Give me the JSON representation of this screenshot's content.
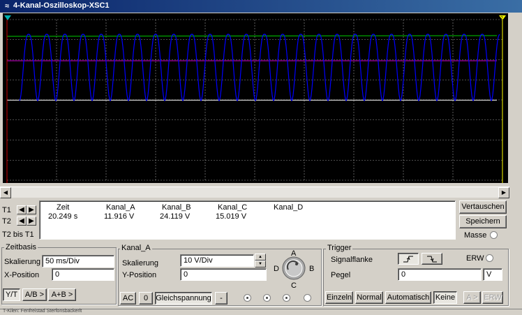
{
  "window": {
    "title": "4-Kanal-Oszilloskop-XSC1",
    "status_text": "T-Kilen: Fenfreistad Sterfonsbackerlt"
  },
  "scope_colors": {
    "background": "#000000",
    "grid": "#ffffff",
    "channel_a": "#00cc00",
    "channel_b": "#0000ff",
    "channel_c": "#cc00cc",
    "channel_d": "#ffffff",
    "cursor_t1": "#cc0000",
    "cursor_t2": "#ffff00"
  },
  "cursors": {
    "t1_label": "T1",
    "t2_label": "T2",
    "t2_bis_t1_label": "T2 bis T1",
    "t1_marker": "1",
    "t2_marker": "2"
  },
  "readout": {
    "headers": [
      "Zeit",
      "Kanal_A",
      "Kanal_B",
      "Kanal_C",
      "Kanal_D"
    ],
    "t1_values": [
      "20.249 s",
      "11.916 V",
      "24.119 V",
      "15.019 V",
      ""
    ]
  },
  "right_panel": {
    "vertauschen": "Vertauschen",
    "speichern": "Speichern",
    "masse": "Masse"
  },
  "zeitbasis": {
    "title": "Zeitbasis",
    "skalierung_label": "Skalierung",
    "skalierung_value": "50 ms/Div",
    "xposition_label": "X-Position",
    "xposition_value": "0",
    "mode_yt": "Y/T",
    "mode_ab": "A/B >",
    "mode_apb": "A+B >"
  },
  "kanal": {
    "title": "Kanal_A",
    "skalierung_label": "Skalierung",
    "skalierung_value": "10  V/Div",
    "yposition_label": "Y-Position",
    "yposition_value": "0",
    "ac": "AC",
    "zero": "0",
    "gleichspannung": "Gleichspannung",
    "minus": "-",
    "knob_labels": {
      "a": "A",
      "b": "B",
      "c": "C",
      "d": "D"
    }
  },
  "trigger": {
    "title": "Trigger",
    "signalflanke_label": "Signalflanke",
    "rising_icon": "⨏",
    "falling_icon": "⨏",
    "erw_label": "ERW",
    "pegel_label": "Pegel",
    "pegel_value": "0",
    "pegel_unit": "V",
    "einzeln": "Einzeln",
    "normal": "Normal",
    "automatisch": "Automatisch",
    "keine": "Keine",
    "a_button": "A >",
    "erw_button": "ERW"
  }
}
